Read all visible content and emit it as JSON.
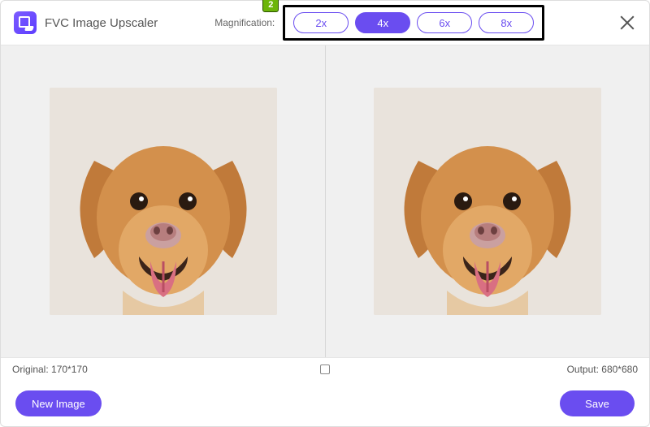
{
  "header": {
    "app_title": "FVC Image Upscaler",
    "magnification_label": "Magnification:",
    "options": [
      "2x",
      "4x",
      "6x",
      "8x"
    ],
    "selected_index": 1,
    "annotation_badge": "2"
  },
  "info": {
    "original_label": "Original:",
    "original_value": "170*170",
    "output_label": "Output:",
    "output_value": "680*680"
  },
  "footer": {
    "new_image_label": "New Image",
    "save_label": "Save"
  }
}
